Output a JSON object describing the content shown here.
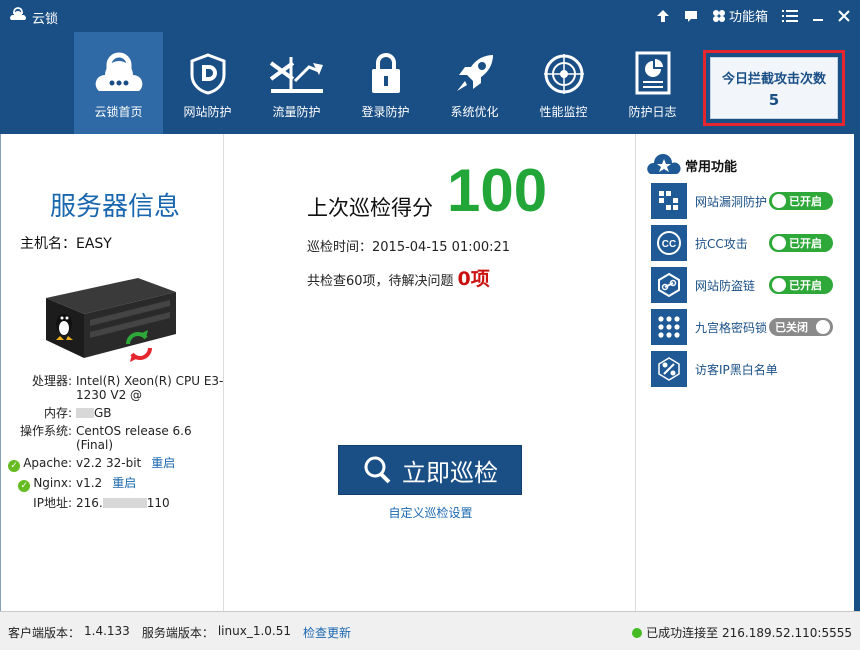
{
  "app": {
    "title": "云锁"
  },
  "titlebar": {
    "toolbox": "功能箱"
  },
  "nav": [
    {
      "label": "云锁首页",
      "icon": "cloud-lock-icon"
    },
    {
      "label": "网站防护",
      "icon": "shield-d-icon"
    },
    {
      "label": "流量防护",
      "icon": "traffic-arrow-icon"
    },
    {
      "label": "登录防护",
      "icon": "padlock-icon"
    },
    {
      "label": "系统优化",
      "icon": "rocket-icon"
    },
    {
      "label": "性能监控",
      "icon": "radar-icon"
    },
    {
      "label": "防护日志",
      "icon": "report-icon"
    }
  ],
  "attack": {
    "label": "今日拦截攻击次数",
    "count": "5"
  },
  "server": {
    "title": "服务器信息",
    "host": "主机名：EASY",
    "cpu_key": "处理器:",
    "cpu_val": "Intel(R) Xeon(R) CPU E3-1230 V2 @",
    "mem_key": "内存:",
    "mem_val": "GB",
    "os_key": "操作系统:",
    "os_val": "CentOS release 6.6 (Final)",
    "apache_key": "Apache:",
    "apache_val": "v2.2 32-bit",
    "apache_restart": "重启",
    "nginx_key": "Nginx:",
    "nginx_val": "v1.2",
    "nginx_restart": "重启",
    "ip_key": "IP地址:",
    "ip_prefix": "216.",
    "ip_suffix": "110"
  },
  "scan": {
    "score_label": "上次巡检得分",
    "score": "100",
    "time": "巡检时间：2015-04-15 01:00:21",
    "summary": "共检查60项，待解决问题",
    "problems": "0项",
    "button": "立即巡检",
    "custom": "自定义巡检设置"
  },
  "common": {
    "title": "常用功能",
    "items": [
      {
        "name": "网站漏洞防护",
        "state": "已开启",
        "on": true,
        "icon": "bug-grid-icon"
      },
      {
        "name": "抗CC攻击",
        "state": "已开启",
        "on": true,
        "icon": "cc-icon"
      },
      {
        "name": "网站防盗链",
        "state": "已开启",
        "on": true,
        "icon": "chain-link-icon"
      },
      {
        "name": "九宫格密码锁",
        "state": "已关闭",
        "on": false,
        "icon": "dot-grid-icon"
      },
      {
        "name": "访客IP黑白名单",
        "state": "",
        "on": null,
        "icon": "percent-icon"
      }
    ]
  },
  "status": {
    "client_label": "客户端版本：",
    "client_ver": "1.4.133",
    "server_label": "服务端版本：",
    "server_ver": "linux_1.0.51",
    "check_update": "检查更新",
    "connected": "已成功连接至 216.189.52.110:5555"
  },
  "colors": {
    "header": "#1a4f86",
    "accent": "#1a67b0",
    "score": "#21a637",
    "alert": "#e5262e",
    "toggle_on": "#2ea838"
  }
}
